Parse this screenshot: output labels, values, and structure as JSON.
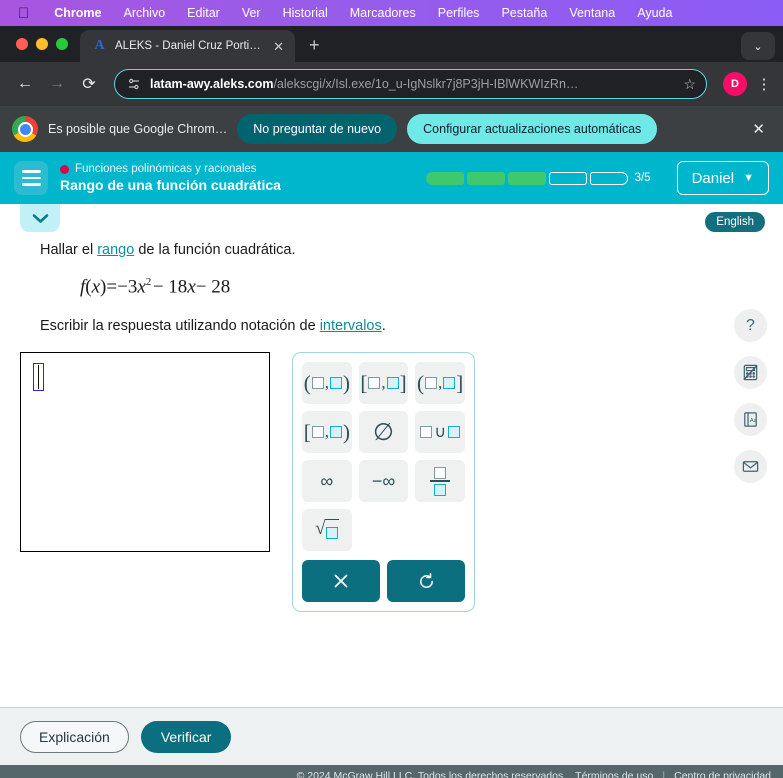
{
  "macos_menubar": {
    "apple_icon": "apple-logo-icon",
    "items": [
      {
        "label": "Chrome",
        "bold": true
      },
      {
        "label": "Archivo",
        "bold": false
      },
      {
        "label": "Editar",
        "bold": false
      },
      {
        "label": "Ver",
        "bold": false
      },
      {
        "label": "Historial",
        "bold": false
      },
      {
        "label": "Marcadores",
        "bold": false
      },
      {
        "label": "Perfiles",
        "bold": false
      },
      {
        "label": "Pestaña",
        "bold": false
      },
      {
        "label": "Ventana",
        "bold": false
      },
      {
        "label": "Ayuda",
        "bold": false
      }
    ]
  },
  "browser": {
    "tab": {
      "favicon_letter": "A",
      "title": "ALEKS - Daniel Cruz Portillo -",
      "close_glyph": "✕"
    },
    "new_tab_glyph": "+",
    "tabstrip_right_glyph": "⌄",
    "nav": {
      "back_glyph": "←",
      "forward_glyph": "→",
      "reload_glyph": "⟳"
    },
    "url": {
      "site_icon": "tune-icon",
      "domain": "latam-awy.aleks.com",
      "path": "/alekscgi/x/Isl.exe/1o_u-IgNslkr7j8P3jH-IBlWKWIzRn…",
      "star_glyph": "☆"
    },
    "profile_initial": "D",
    "menu_glyph": "⋮"
  },
  "infobar": {
    "logo": "chrome-logo-icon",
    "message": "Es posible que Google Chrom…",
    "dismiss_label": "No preguntar de nuevo",
    "primary_label": "Configurar actualizaciones automáticas",
    "close_glyph": "✕"
  },
  "aleks_header": {
    "menu_icon": "hamburger-menu-icon",
    "topic": "Funciones polinómicas y racionales",
    "title": "Rango de una función cuadrática",
    "progress": {
      "total": 5,
      "completed": 3,
      "count_label": "3/5"
    },
    "user_name": "Daniel",
    "user_chevron": "⌄"
  },
  "content": {
    "collapse_glyph": "⌄",
    "language_badge": "English",
    "prompt_prefix": "Hallar el ",
    "prompt_link": "rango",
    "prompt_suffix": " de la función cuadrática.",
    "formula": {
      "fn": "f",
      "var_open": "(",
      "var": "x",
      "var_close": ")",
      "equals": "=",
      "term1_sign": "−",
      "term1_coef": "3",
      "term1_var": "x",
      "term1_exp": "2",
      "term2": "− 18",
      "term2_var": "x",
      "term3": "− 28"
    },
    "instruction_prefix": "Escribir la respuesta utilizando notación de ",
    "instruction_link": "intervalos",
    "instruction_suffix": ".",
    "answer_value": ""
  },
  "keypad": {
    "keys": [
      [
        {
          "name": "open-open-interval-key",
          "parts": [
            "(",
            "box",
            ",",
            "cybox",
            ")"
          ]
        },
        {
          "name": "closed-closed-interval-key",
          "parts": [
            "[",
            "box",
            ",",
            "cybox",
            "]"
          ]
        },
        {
          "name": "open-closed-interval-key",
          "parts": [
            "(",
            "box",
            ",",
            "cybox",
            "]"
          ]
        }
      ],
      [
        {
          "name": "closed-open-interval-key",
          "parts": [
            "[",
            "box",
            ",",
            "cybox",
            ")"
          ]
        },
        {
          "name": "empty-set-key",
          "parts": [
            "Ø"
          ]
        },
        {
          "name": "union-key",
          "parts": [
            "box",
            "∪",
            "cybox"
          ]
        }
      ],
      [
        {
          "name": "infinity-key",
          "parts": [
            "∞"
          ]
        },
        {
          "name": "negative-infinity-key",
          "parts": [
            "−∞"
          ]
        },
        {
          "name": "fraction-key",
          "parts": [
            "frac"
          ]
        }
      ],
      [
        {
          "name": "square-root-key",
          "parts": [
            "sqrt"
          ]
        }
      ]
    ],
    "actions": [
      {
        "name": "clear-button",
        "glyph": "✕"
      },
      {
        "name": "undo-button",
        "glyph": "↺"
      }
    ]
  },
  "rail": [
    {
      "name": "help-icon",
      "glyph": "?"
    },
    {
      "name": "calculator-disabled-icon",
      "glyph": "calc"
    },
    {
      "name": "glossary-icon",
      "glyph": "Aa"
    },
    {
      "name": "message-icon",
      "glyph": "✉"
    }
  ],
  "footer": {
    "explanation_label": "Explicación",
    "verify_label": "Verificar",
    "copyright": "© 2024 McGraw Hill LLC. Todos los derechos reservados.",
    "terms_label": "Términos de uso",
    "separator": "|",
    "privacy_label": "Centro de privacidad"
  },
  "colors": {
    "aleks_teal": "#00b6cd",
    "action_teal": "#0b6f80",
    "progress_green": "#3ec96e",
    "topic_red": "#d70a4e",
    "link": "#0e8c9e"
  }
}
